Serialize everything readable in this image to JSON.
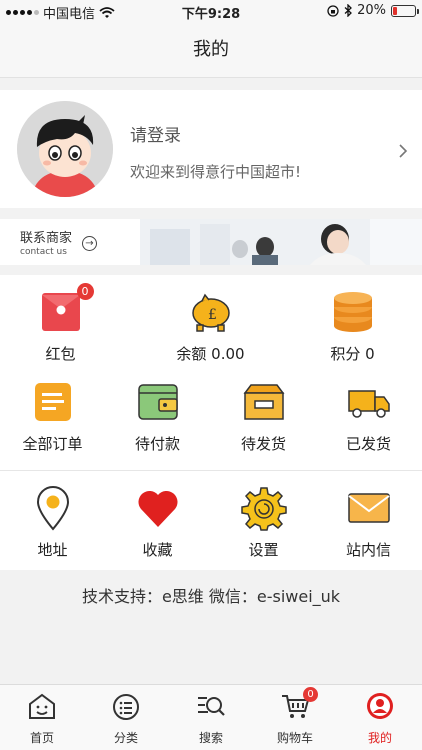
{
  "status_bar": {
    "carrier": "中国电信",
    "time": "下午9:28",
    "battery_percent": "20%",
    "battery_level": 0.2,
    "icons": [
      "signal-dots-icon",
      "wifi-icon",
      "orientation-lock-icon",
      "bluetooth-icon",
      "battery-icon"
    ]
  },
  "header": {
    "title": "我的"
  },
  "profile": {
    "login_text": "请登录",
    "welcome_text": "欢迎来到得意行中国超市!",
    "avatar_icon": "avatar-cartoon-boy-icon",
    "chevron_icon": "chevron-right-icon"
  },
  "contact_banner": {
    "title": "联系商家",
    "subtitle": "contact us",
    "arrow_icon": "arrow-right-circle-icon"
  },
  "quick_grid": {
    "items": [
      {
        "label": "红包",
        "icon": "red-envelope-icon",
        "badge": "0"
      },
      {
        "label": "余额 0.00",
        "icon": "piggy-bank-icon"
      },
      {
        "label": "积分 0",
        "icon": "coin-stack-icon"
      },
      {
        "label": "全部订单",
        "icon": "order-list-icon"
      },
      {
        "label": "待付款",
        "icon": "wallet-icon"
      },
      {
        "label": "待发货",
        "icon": "package-box-icon"
      },
      {
        "label": "已发货",
        "icon": "delivery-truck-icon"
      },
      {
        "label": "地址",
        "icon": "location-pin-icon"
      },
      {
        "label": "收藏",
        "icon": "heart-icon"
      },
      {
        "label": "设置",
        "icon": "gear-icon"
      },
      {
        "label": "站内信",
        "icon": "mail-envelope-icon"
      }
    ]
  },
  "support": {
    "text": "技术支持：e思维 微信：e-siwei_uk"
  },
  "tab_bar": {
    "tabs": [
      {
        "label": "首页",
        "icon": "home-face-icon"
      },
      {
        "label": "分类",
        "icon": "category-list-icon"
      },
      {
        "label": "搜索",
        "icon": "search-icon"
      },
      {
        "label": "购物车",
        "icon": "shopping-cart-icon",
        "badge": "0"
      },
      {
        "label": "我的",
        "icon": "user-profile-icon",
        "active": true
      }
    ]
  },
  "colors": {
    "accent": "#e02020",
    "red_envelope": "#e9474d",
    "gold": "#f5a623",
    "orange": "#f49b2c",
    "green": "#7cc16a"
  }
}
